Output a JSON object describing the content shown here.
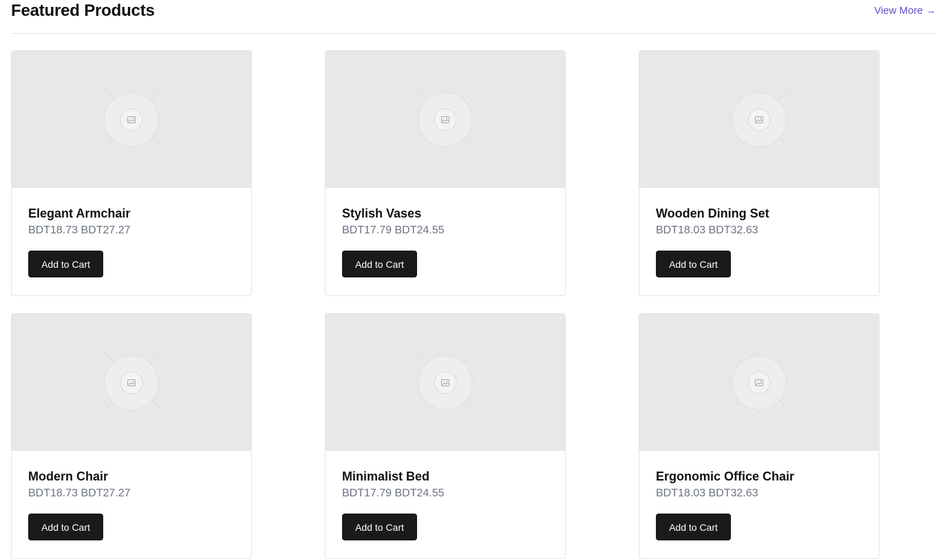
{
  "header": {
    "title": "Featured Products",
    "view_more": "View More →"
  },
  "products": [
    {
      "name": "Elegant Armchair",
      "price": "BDT18.73 BDT27.27",
      "button": "Add to Cart",
      "image_icon": "image-placeholder-icon"
    },
    {
      "name": "Stylish Vases",
      "price": "BDT17.79 BDT24.55",
      "button": "Add to Cart",
      "image_icon": "image-placeholder-icon"
    },
    {
      "name": "Wooden Dining Set",
      "price": "BDT18.03 BDT32.63",
      "button": "Add to Cart",
      "image_icon": "image-placeholder-icon"
    },
    {
      "name": "Modern Chair",
      "price": "BDT18.73 BDT27.27",
      "button": "Add to Cart",
      "image_icon": "image-placeholder-icon"
    },
    {
      "name": "Minimalist Bed",
      "price": "BDT17.79 BDT24.55",
      "button": "Add to Cart",
      "image_icon": "image-placeholder-icon"
    },
    {
      "name": "Ergonomic Office Chair",
      "price": "BDT18.03 BDT32.63",
      "button": "Add to Cart",
      "image_icon": "image-placeholder-icon"
    }
  ],
  "colors": {
    "accent_link": "#5b50c4",
    "button_bg": "#1a1a1c",
    "price_text": "#6b7280",
    "placeholder_bg": "#e8e8e8"
  }
}
